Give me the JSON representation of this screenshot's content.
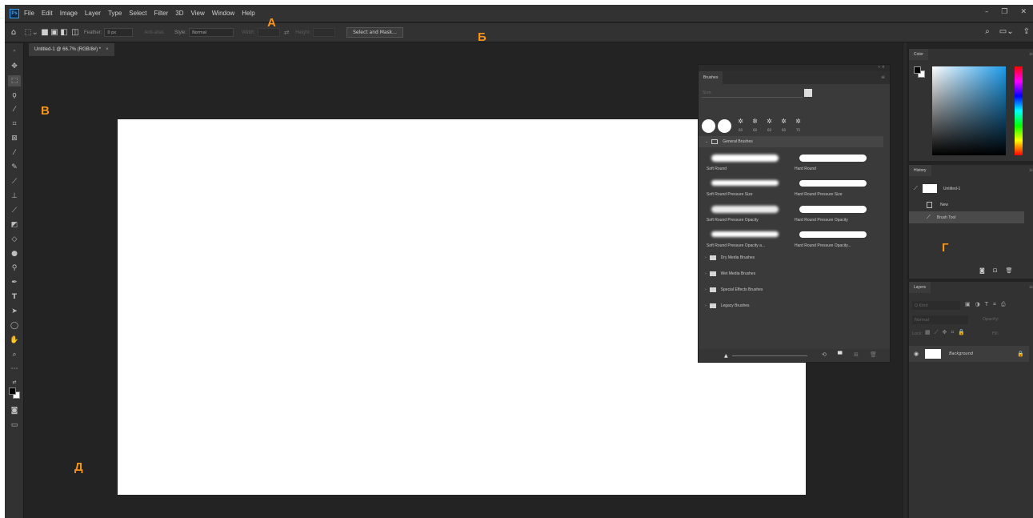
{
  "menu": [
    "File",
    "Edit",
    "Image",
    "Layer",
    "Type",
    "Select",
    "Filter",
    "3D",
    "View",
    "Window",
    "Help"
  ],
  "app_badge": "Ps",
  "options": {
    "feather_label": "Feather:",
    "feather_value": "0 px",
    "antialias_label": "Anti-alias",
    "style_label": "Style:",
    "style_value": "Normal",
    "width_label": "Width:",
    "height_label": "Height:",
    "select_mask_button": "Select and Mask..."
  },
  "document_tab": "Untitled-1 @ 66.7% (RGB/8#) *",
  "brushes_panel": {
    "title": "Brushes",
    "size_label": "Size:",
    "general_folder": "General Brushes",
    "presets": [
      "Soft Round",
      "Hard Round",
      "Soft Round Pressure Size",
      "Hard Round Pressure Size",
      "Soft Round Pressure Opacity",
      "Hard Round Pressure Opacity",
      "Soft Round Pressure Opacity a...",
      "Hard Round Pressure Opacity..."
    ],
    "recent_sizes": [
      "60",
      "60",
      "60",
      "60",
      "75"
    ],
    "folders": [
      "Dry Media Brushes",
      "Wet Media Brushes",
      "Special Effects Brushes",
      "Legacy Brushes"
    ]
  },
  "color_panel": {
    "title": "Color"
  },
  "history_panel": {
    "title": "History",
    "snapshot": "Untitled-1",
    "items": [
      "New",
      "Brush Tool"
    ]
  },
  "layers_panel": {
    "title": "Layers",
    "search_placeholder": "Q Kind",
    "blend_mode": "Normal",
    "opacity_label": "Opacity:",
    "lock_label": "Lock:",
    "fill_label": "Fill:",
    "layer_name": "Background"
  },
  "annotations": {
    "a": "А",
    "b": "Б",
    "v": "В",
    "g": "Г",
    "d": "Д"
  },
  "colors": {
    "annotation": "#f7941d",
    "workspace": "#232323",
    "panel": "#323232"
  }
}
